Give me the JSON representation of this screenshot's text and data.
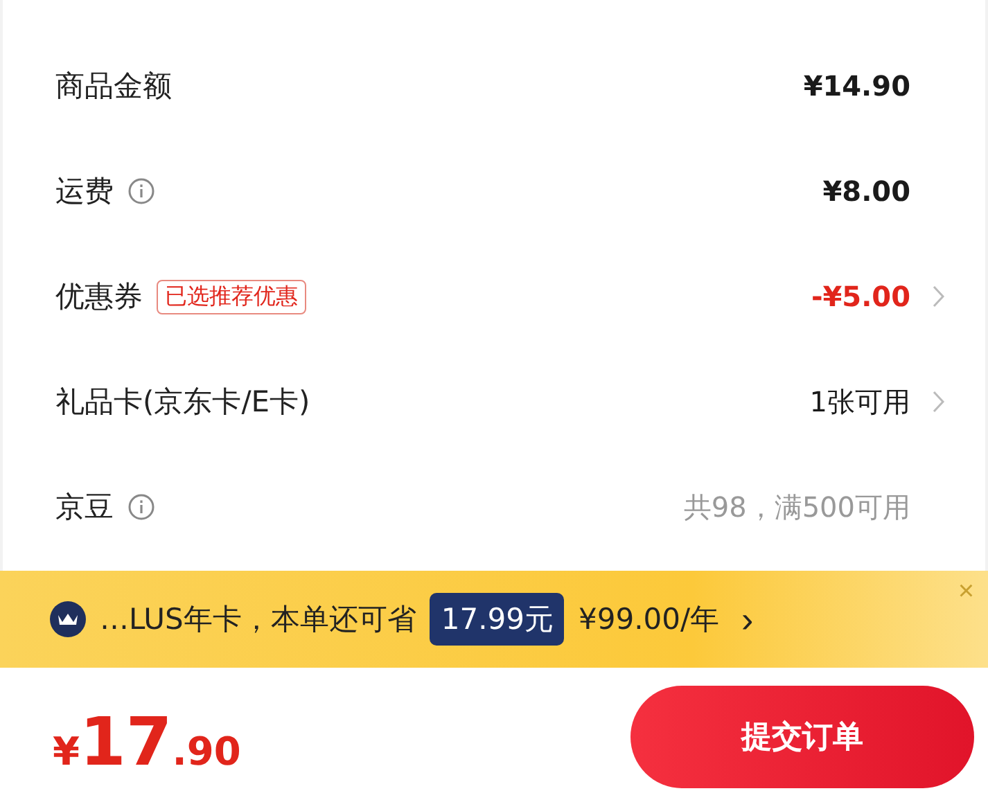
{
  "summary_rows": [
    {
      "label": "商品金额",
      "info": false,
      "value": "¥14.90",
      "kind": "strong",
      "arrow": false
    },
    {
      "label": "运费",
      "info": true,
      "value": "¥8.00",
      "kind": "strong",
      "arrow": false
    },
    {
      "label": "优惠券",
      "info": false,
      "tag": "已选推荐优惠",
      "value": "-¥5.00",
      "kind": "discount",
      "arrow": true
    },
    {
      "label": "礼品卡(京东卡/E卡)",
      "info": false,
      "value": "1张可用",
      "kind": "normal",
      "arrow": true
    },
    {
      "label": "京豆",
      "info": true,
      "value": "共98，满500可用",
      "kind": "muted",
      "arrow": false
    }
  ],
  "promo_banner": {
    "text": "…LUS年卡，本单还可省",
    "savings": "17.99元",
    "price": "¥99.00/年",
    "arrow": "›",
    "close": "×"
  },
  "footer": {
    "currency": "¥",
    "amount_integer": "17",
    "amount_decimal": ".90",
    "submit_button": "提交订单"
  }
}
